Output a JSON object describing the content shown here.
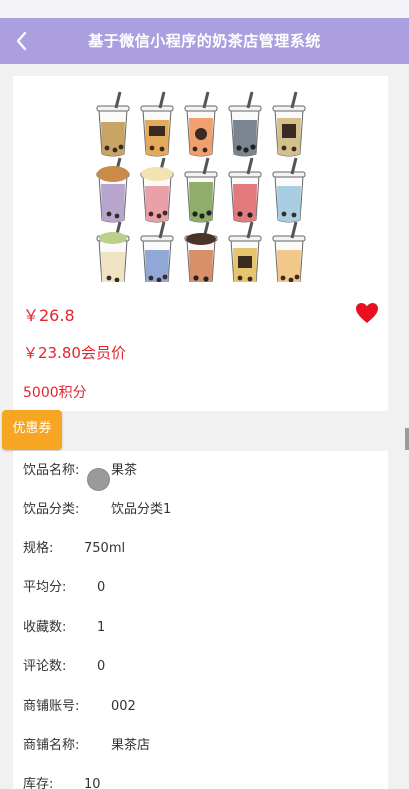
{
  "header": {
    "title": "基于微信小程序的奶茶店管理系统",
    "back_icon": "chevron-left-icon"
  },
  "product": {
    "price": "￥26.8",
    "vip_price": "￥23.80会员价",
    "points": "5000积分",
    "favorite_icon": "heart-icon",
    "favorite_color": "#e8101f"
  },
  "coupon_button": "优惠券",
  "details": [
    {
      "label": "饮品名称:",
      "value": "果茶"
    },
    {
      "label": "饮品分类:",
      "value": "饮品分类1"
    },
    {
      "label": "规格:",
      "value": "750ml"
    },
    {
      "label": "平均分:",
      "value": "0"
    },
    {
      "label": "收藏数:",
      "value": "1"
    },
    {
      "label": "评论数:",
      "value": "0"
    },
    {
      "label": "商铺账号:",
      "value": "002"
    },
    {
      "label": "商铺名称:",
      "value": "果茶店"
    },
    {
      "label": "库存:",
      "value": "10"
    }
  ],
  "colors": {
    "header": "#ab9fe0",
    "price": "#e0262e",
    "coupon": "#f6a623"
  }
}
